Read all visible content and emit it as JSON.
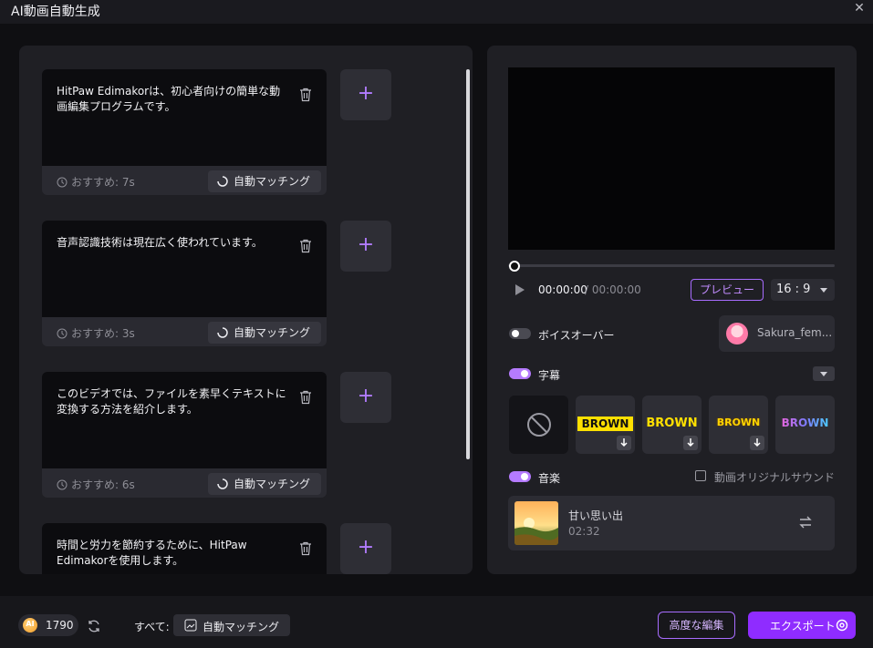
{
  "window": {
    "title": "AI動画自動生成"
  },
  "scripts": [
    {
      "text": "HitPaw Edimakorは、初心者向けの簡単な動画編集プログラムです。",
      "recommend": "おすすめ: 7s",
      "match_label": "自動マッチング"
    },
    {
      "text": "音声認識技術は現在広く使われています。",
      "recommend": "おすすめ: 3s",
      "match_label": "自動マッチング"
    },
    {
      "text": "このビデオでは、ファイルを素早くテキストに変換する方法を紹介します。",
      "recommend": "おすすめ: 6s",
      "match_label": "自動マッチング"
    },
    {
      "text": "時間と労力を節約するために、HitPaw Edimakorを使用します。",
      "recommend": "",
      "match_label": ""
    }
  ],
  "add_icon": "+",
  "player": {
    "current_time": "00:00:00",
    "total_time": "/ 00:00:00",
    "preview_label": "プレビュー",
    "ratio": "16 : 9",
    "progress": 0
  },
  "voiceover": {
    "label": "ボイスオーバー",
    "enabled": false,
    "voice_name": "Sakura_fem..."
  },
  "subtitles": {
    "label": "字幕",
    "enabled": true,
    "styles": [
      {
        "name": "none",
        "text": ""
      },
      {
        "name": "brown-black-on-yellow",
        "text": "BROWN"
      },
      {
        "name": "brown-yellow",
        "text": "BROWN"
      },
      {
        "name": "brown-yellow-outline",
        "text": "BROWN"
      },
      {
        "name": "brown-gradient",
        "text": "BROWN"
      }
    ]
  },
  "music": {
    "label": "音楽",
    "enabled": true,
    "original_sound_label": "動画オリジナルサウンド",
    "original_sound_checked": false,
    "track_title": "甘い思い出",
    "track_duration": "02:32"
  },
  "footer": {
    "credits": "1790",
    "coin_label": "AI",
    "all_label": "すべて:",
    "all_match_label": "自動マッチング",
    "advanced_label": "高度な編集",
    "export_label": "エクスポート"
  },
  "colors": {
    "accent": "#b57bff",
    "export": "#8f2cff",
    "panel": "#1f1f24",
    "background": "#0f0f12"
  }
}
